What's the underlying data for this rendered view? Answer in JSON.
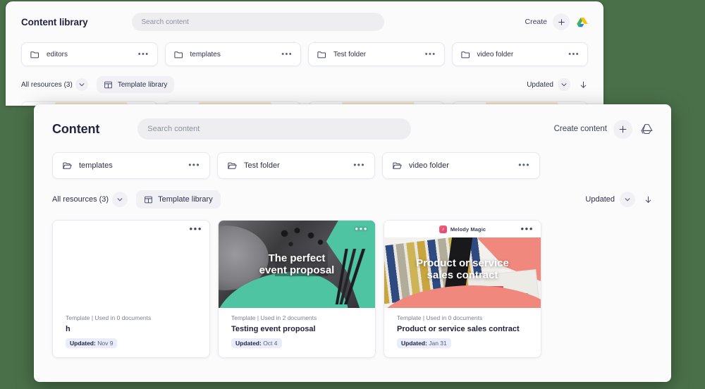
{
  "background_color": "#4a7049",
  "back_window": {
    "title": "Content library",
    "search": {
      "placeholder": "Search content"
    },
    "header_actions": {
      "create_label": "Create",
      "plus_label": "+",
      "drive_icon": "google-drive-icon"
    },
    "folders": [
      {
        "name": "editors",
        "menu": "•••"
      },
      {
        "name": "templates",
        "menu": "•••"
      },
      {
        "name": "Test folder",
        "menu": "•••"
      },
      {
        "name": "video folder",
        "menu": "•••"
      }
    ],
    "filters": {
      "resources_label": "All resources (3)",
      "template_library_label": "Template library"
    },
    "sort": {
      "label": "Updated",
      "direction_icon": "arrow-down-icon"
    },
    "cards": [
      {
        "menu": "•••"
      },
      {
        "menu": "•••"
      },
      {
        "menu": "•••"
      },
      {
        "menu": "•••"
      }
    ]
  },
  "front_window": {
    "title": "Content",
    "search": {
      "placeholder": "Search content"
    },
    "header_actions": {
      "create_label": "Create content",
      "plus_label": "+",
      "drive_icon": "google-drive-icon"
    },
    "folders": [
      {
        "name": "templates",
        "menu": "•••"
      },
      {
        "name": "Test folder",
        "menu": "•••"
      },
      {
        "name": "video folder",
        "menu": "•••"
      }
    ],
    "filters": {
      "resources_label": "All resources (3)",
      "template_library_label": "Template library"
    },
    "sort": {
      "label": "Updated",
      "direction_icon": "arrow-down-icon"
    },
    "cards": [
      {
        "thumbnail": "blank",
        "thumb_caption": "",
        "menu": "•••",
        "subtitle": "Template | Used in 0 documents",
        "title": "h",
        "badge_label": "Updated:",
        "badge_value": "Nov 9"
      },
      {
        "thumbnail": "event-proposal-photo",
        "thumb_caption": "The perfect\nevent proposal",
        "menu": "•••",
        "subtitle": "Template | Used in 2 documents",
        "title": "Testing event proposal",
        "badge_label": "Updated:",
        "badge_value": "Oct 4"
      },
      {
        "thumbnail": "sales-contract-photo",
        "brand_name": "Melody Magic",
        "brand_mark": "♪",
        "thumb_caption": "Product or service\nsales contract",
        "menu": "•••",
        "subtitle": "Template | Used in 0 documents",
        "title": "Product or service sales contract",
        "badge_label": "Updated:",
        "badge_value": "Jan 31"
      }
    ]
  }
}
